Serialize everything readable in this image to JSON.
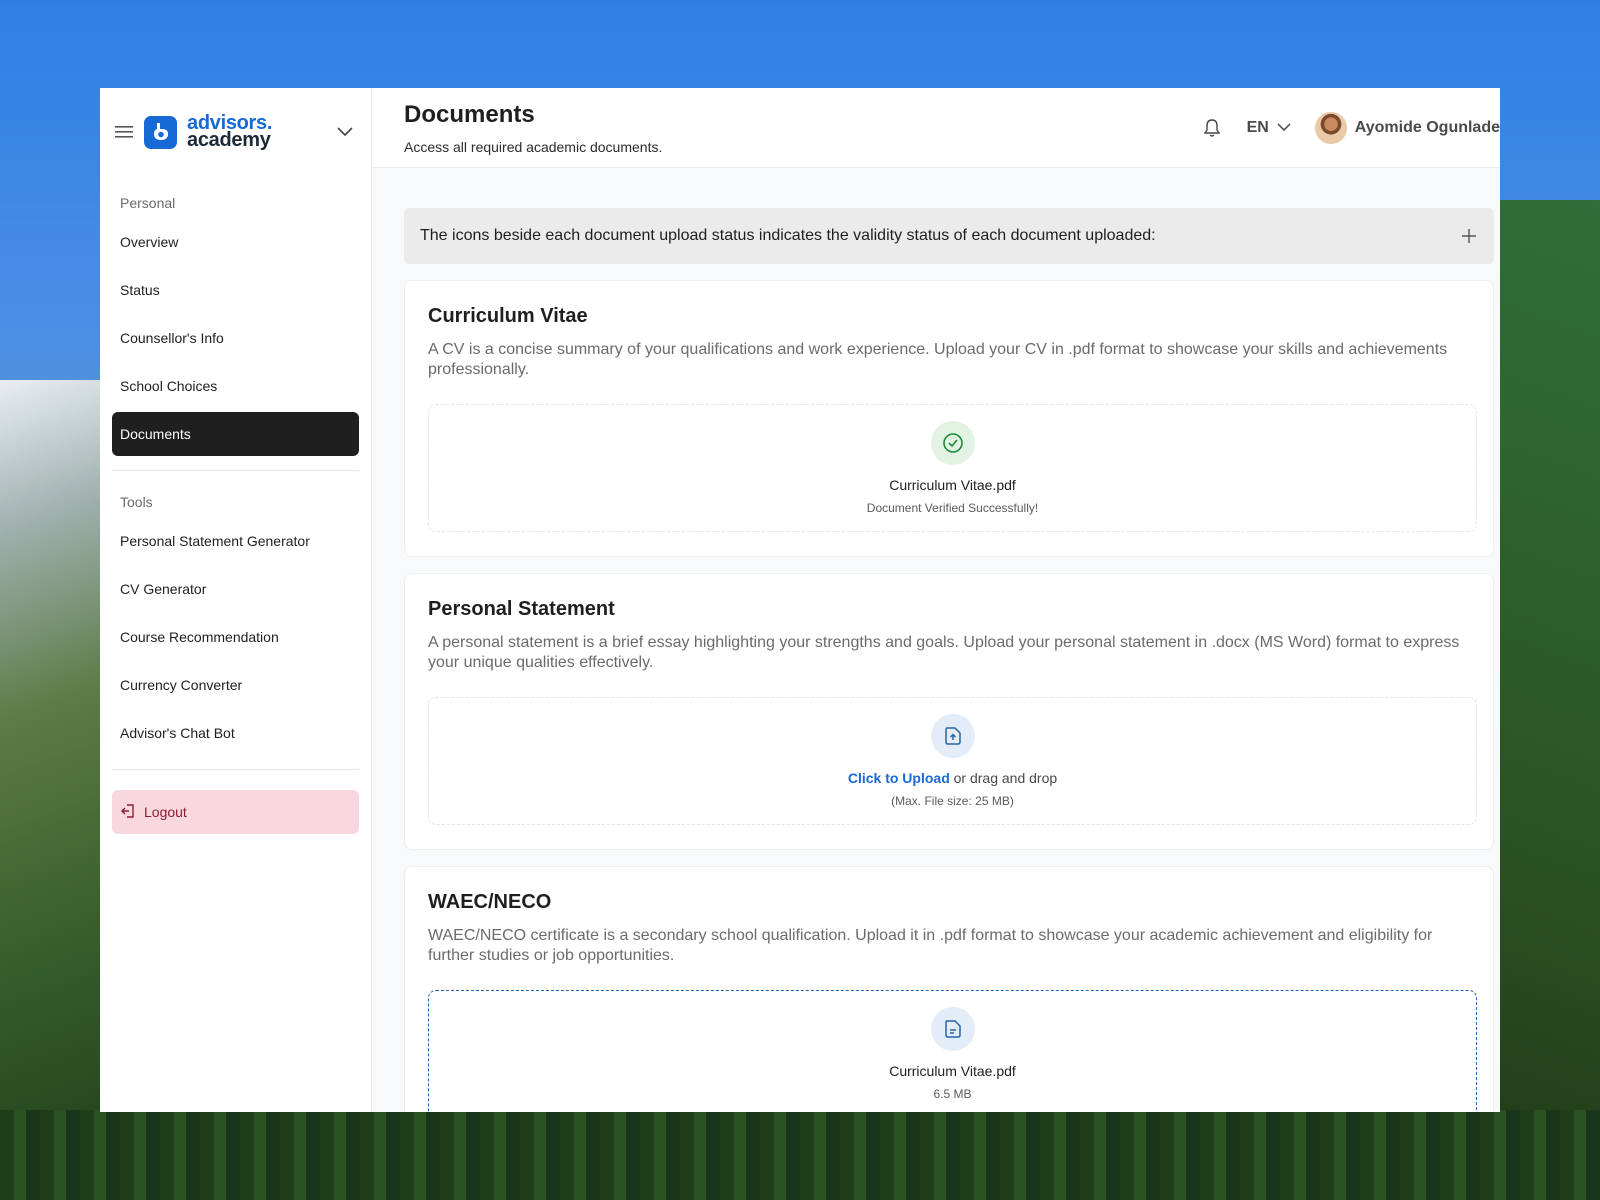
{
  "brand": {
    "line1": "advisors.",
    "line2": "academy"
  },
  "sidebar": {
    "personal_label": "Personal",
    "personal_items": [
      {
        "label": "Overview"
      },
      {
        "label": "Status"
      },
      {
        "label": "Counsellor's Info"
      },
      {
        "label": "School Choices"
      },
      {
        "label": "Documents",
        "active": true
      }
    ],
    "tools_label": "Tools",
    "tools_items": [
      {
        "label": "Personal Statement Generator"
      },
      {
        "label": "CV Generator"
      },
      {
        "label": "Course Recommendation"
      },
      {
        "label": "Currency Converter"
      },
      {
        "label": "Advisor's Chat Bot"
      }
    ],
    "logout_label": "Logout"
  },
  "header": {
    "title": "Documents",
    "subtitle": "Access all required academic documents.",
    "language": "EN",
    "user_name": "Ayomide Ogunlade"
  },
  "info_bar": {
    "text": "The icons beside each document upload status indicates the validity status of each document uploaded:"
  },
  "documents": [
    {
      "title": "Curriculum Vitae",
      "description": "A CV is a concise summary of your qualifications and work experience. Upload your CV in .pdf format to showcase your skills and achievements professionally.",
      "file_name": "Curriculum Vitae.pdf",
      "status_text": "Document Verified Successfully!"
    },
    {
      "title": "Personal Statement",
      "description": "A personal statement is a brief essay highlighting your strengths and goals. Upload your personal statement in .docx (MS Word) format to express your unique qualities effectively.",
      "upload_link": "Click to Upload",
      "upload_rest": " or drag and drop",
      "max_size": "(Max. File size: 25 MB)"
    },
    {
      "title": "WAEC/NECO",
      "description": "WAEC/NECO certificate is a secondary school qualification. Upload it in .pdf format to showcase your academic achievement and eligibility for further studies or job opportunities.",
      "file_name": "Curriculum Vitae.pdf",
      "file_size": "6.5 MB"
    }
  ],
  "colors": {
    "accent": "#1769d6",
    "active_nav": "#1f1f1f",
    "logout_bg": "#f8d7de",
    "verified_green": "#1a8a3a"
  }
}
